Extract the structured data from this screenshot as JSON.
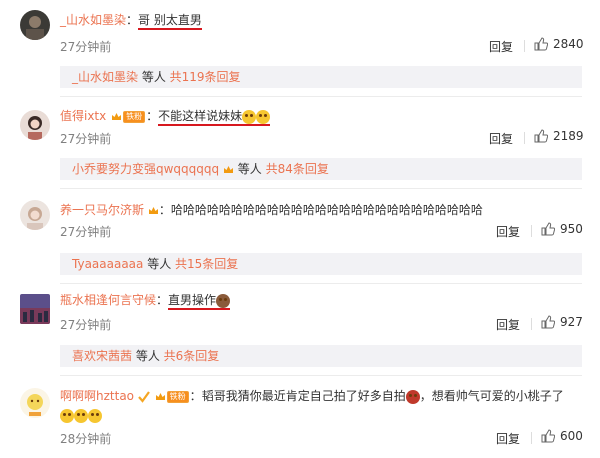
{
  "comments": [
    {
      "user": "_山水如墨染",
      "sep": "：",
      "text": "哥 别太直男",
      "time": "27分钟前",
      "reply": "回复",
      "likes": "2840",
      "sub": {
        "user": "_山水如墨染",
        "mid": " 等人 ",
        "count": "共119条回复"
      }
    },
    {
      "user": "值得ixtx",
      "sep": "：",
      "text": "不能这样说妹妹",
      "time": "27分钟前",
      "reply": "回复",
      "likes": "2189",
      "badge": "铁粉",
      "sub": {
        "user": "小乔要努力变强qwqqqqqq",
        "mid": " 等人 ",
        "count": "共84条回复"
      }
    },
    {
      "user": "养一只马尔济斯",
      "sep": "：",
      "text": "哈哈哈哈哈哈哈哈哈哈哈哈哈哈哈哈哈哈哈哈哈哈哈哈哈哈",
      "time": "27分钟前",
      "reply": "回复",
      "likes": "950",
      "sub": {
        "user": "Tyaaaaaaaa",
        "mid": " 等人 ",
        "count": "共15条回复"
      }
    },
    {
      "user": "瓶水相逢何言守候",
      "sep": "：",
      "text": "直男操作",
      "time": "27分钟前",
      "reply": "回复",
      "likes": "927",
      "sub": {
        "user": "喜欢宋茜茜",
        "mid": " 等人 ",
        "count": "共6条回复"
      }
    },
    {
      "user": "啊啊啊hzttao",
      "sep": "：",
      "text": "韬哥我猜你最近肯定自己拍了好多自拍",
      "text2": "，想看帅气可爱的小桃子了",
      "time": "28分钟前",
      "reply": "回复",
      "likes": "600",
      "badge": "铁粉"
    }
  ],
  "colors": {
    "username": "#eb7350",
    "underline": "#d7181f",
    "subbg": "#f2f2f5"
  }
}
